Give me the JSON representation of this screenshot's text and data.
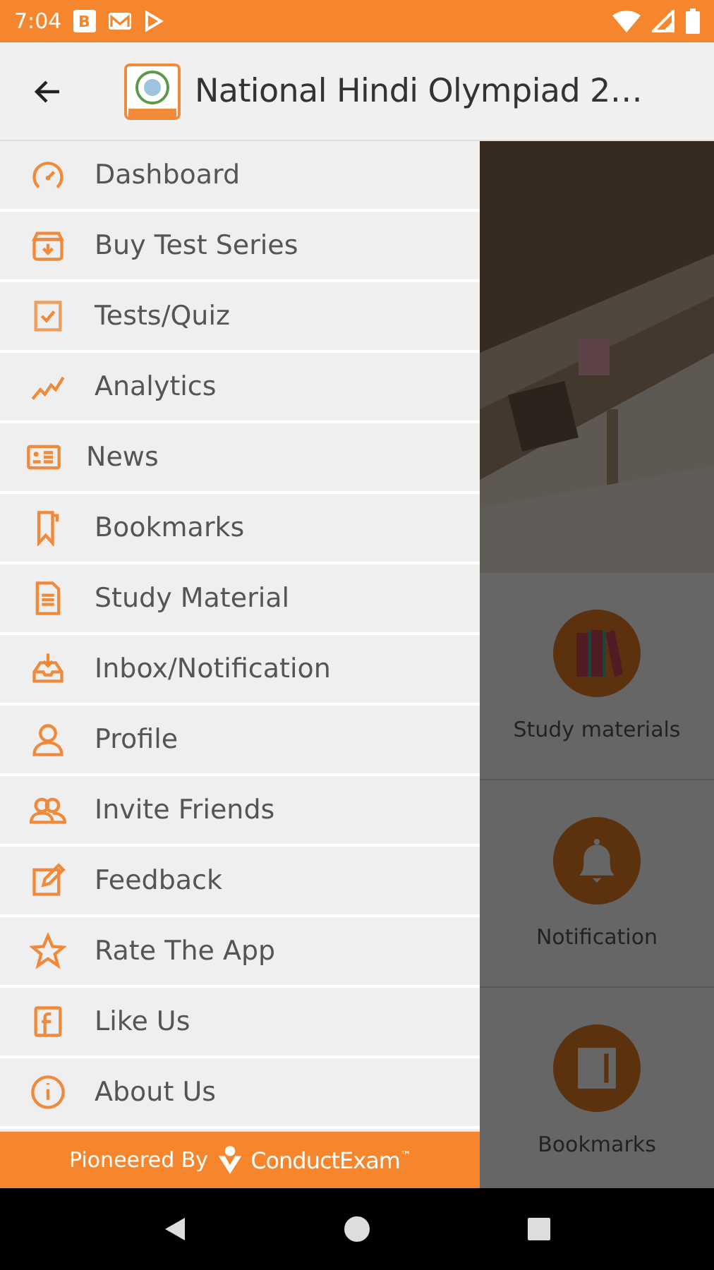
{
  "status_bar": {
    "time": "7:04",
    "notification_badge": "B"
  },
  "app_bar": {
    "title": "National Hindi Olympiad 2…"
  },
  "drawer": {
    "items": [
      {
        "label": "Dashboard"
      },
      {
        "label": "Buy Test Series"
      },
      {
        "label": "Tests/Quiz"
      },
      {
        "label": "Analytics"
      },
      {
        "label": "News"
      },
      {
        "label": "Bookmarks"
      },
      {
        "label": "Study Material"
      },
      {
        "label": "Inbox/Notification"
      },
      {
        "label": "Profile"
      },
      {
        "label": "Invite Friends"
      },
      {
        "label": "Feedback"
      },
      {
        "label": "Rate The App"
      },
      {
        "label": "Like Us"
      },
      {
        "label": "About Us"
      }
    ],
    "footer": {
      "label": "Pioneered By",
      "brand": "ConductExam$^{™}$"
    }
  },
  "home": {
    "tiles": [
      {
        "label": "Study materials"
      },
      {
        "label": "Notification"
      },
      {
        "label": "Bookmarks"
      }
    ]
  }
}
